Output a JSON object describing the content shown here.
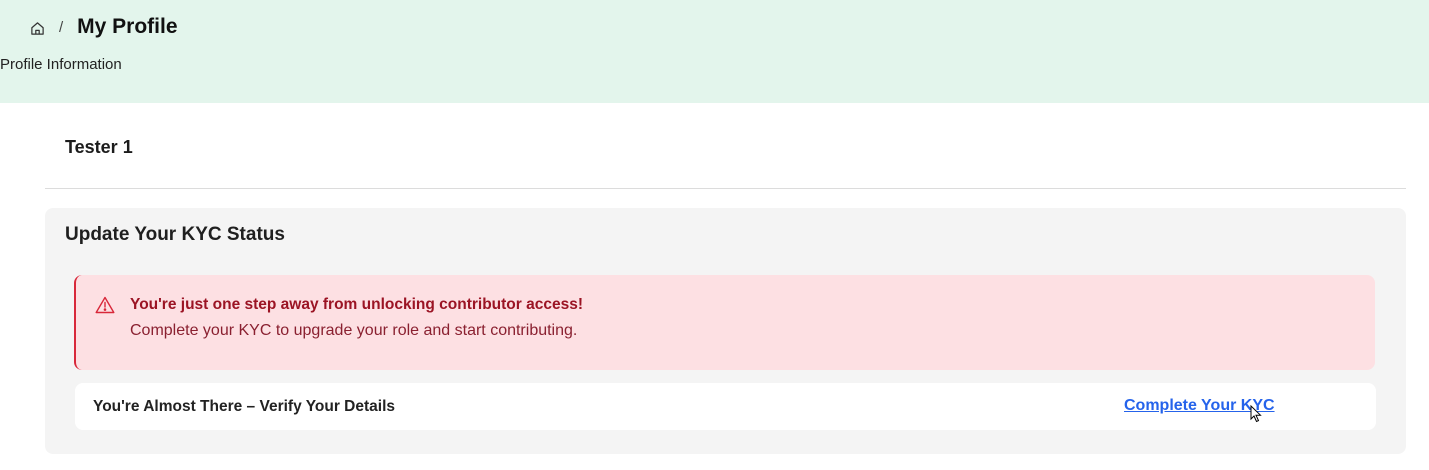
{
  "header": {
    "breadcrumb": {
      "home_icon": "home-icon",
      "separator": "/",
      "title": "My Profile"
    },
    "subtitle": "Profile Information",
    "background_color": "#e3f5ec"
  },
  "profile": {
    "name": "Tester 1"
  },
  "kyc": {
    "heading": "Update Your KYC Status",
    "alert": {
      "icon": "warning-triangle-icon",
      "title": "You're just one step away from unlocking contributor access!",
      "body": "Complete your KYC to upgrade your role and start contributing.",
      "accent_color": "#d8283a",
      "background_color": "#fde0e3"
    },
    "verify": {
      "label": "You're Almost There – Verify Your Details",
      "link_text": "Complete Your KYC",
      "link_color": "#2563eb"
    }
  }
}
